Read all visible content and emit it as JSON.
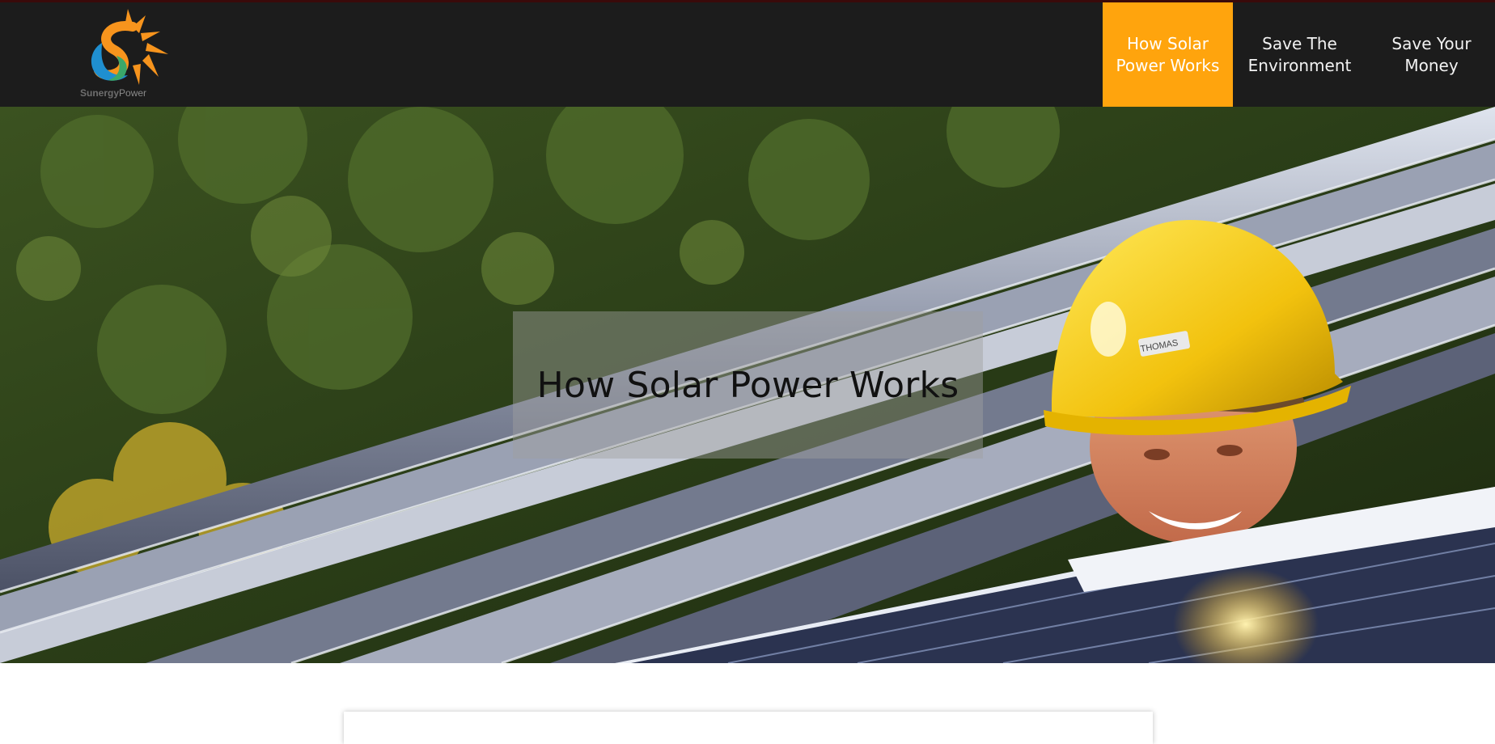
{
  "brand": {
    "name_part1": "Sunergy",
    "name_part2": "Power",
    "logo_icon": "sun-s-logo-icon",
    "colors": {
      "orange": "#f7941d",
      "blue": "#1f8fd0",
      "green": "#3aa86a"
    }
  },
  "nav": {
    "items": [
      {
        "label": "How Solar Power Works",
        "active": true
      },
      {
        "label": "Save The Environment",
        "active": false
      },
      {
        "label": "Save Your Money",
        "active": false
      }
    ],
    "active_color": "#ffa40d",
    "background": "#1c1c1c"
  },
  "hero": {
    "title": "How Solar Power Works",
    "helmet_label": "THOMAS",
    "image_subject": "solar-worker-photo"
  }
}
